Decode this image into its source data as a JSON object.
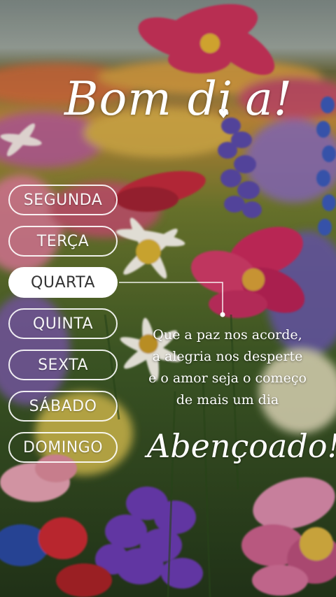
{
  "greeting": {
    "title_prefix": "Bom di",
    "title_suffix": "a!",
    "heart_glyph": "♥"
  },
  "weekdays": [
    {
      "label": "SEGUNDA",
      "active": false
    },
    {
      "label": "TERÇA",
      "active": false
    },
    {
      "label": "QUARTA",
      "active": true
    },
    {
      "label": "QUINTA",
      "active": false
    },
    {
      "label": "SEXTA",
      "active": false
    },
    {
      "label": "SÁBADO",
      "active": false
    },
    {
      "label": "DOMINGO",
      "active": false
    }
  ],
  "quote": {
    "lines": [
      "Que a paz nos acorde,",
      "a alegria nos desperte",
      "e o amor seja o começo",
      "de mais um dia"
    ],
    "closing": "Abençoado!"
  },
  "colors": {
    "text": "#ffffff",
    "active_pill_bg": "#ffffff",
    "active_pill_text": "#333333"
  }
}
